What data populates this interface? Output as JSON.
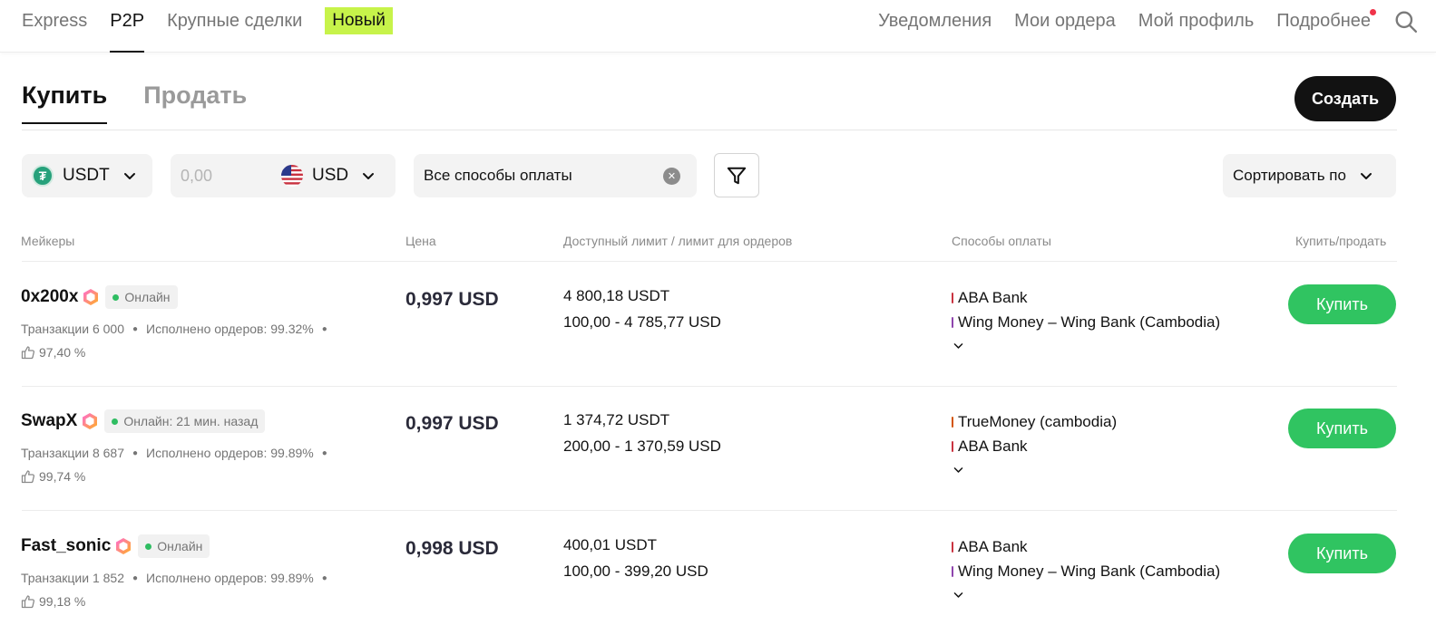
{
  "nav": {
    "left": [
      "Express",
      "P2P",
      "Крупные сделки"
    ],
    "badge": "Новый",
    "right": [
      "Уведомления",
      "Мои ордера",
      "Мой профиль",
      "Подробнее"
    ]
  },
  "tabs": {
    "buy": "Купить",
    "sell": "Продать"
  },
  "create_button": "Создать",
  "filters": {
    "coin": "USDT",
    "amount_placeholder": "0,00",
    "fiat": "USD",
    "payment": "Все способы оплаты",
    "sort": "Сортировать по"
  },
  "columns": [
    "Мейкеры",
    "Цена",
    "Доступный лимит / лимит для ордеров",
    "Способы оплаты",
    "Купить/продать"
  ],
  "colors": {
    "accent_green": "#30c461",
    "badge_lime": "#c7f34a",
    "online_dot": "#2fbd62"
  },
  "rows": [
    {
      "name": "0x200x",
      "status": "Онлайн",
      "transactions": "Транзакции 6 000",
      "completed": "Исполнено ордеров: 99.32%",
      "rating": "97,40 %",
      "price": "0,997 USD",
      "available": "4 800,18 USDT",
      "limits": "100,00 - 4 785,77 USD",
      "payments": [
        {
          "name": "ABA Bank",
          "color": "#c93340"
        },
        {
          "name": "Wing Money – Wing Bank (Cambodia)",
          "color": "#8e44ad"
        }
      ],
      "action": "Купить"
    },
    {
      "name": "SwapX",
      "status": "Онлайн: 21 мин. назад",
      "transactions": "Транзакции 8 687",
      "completed": "Исполнено ордеров: 99.89%",
      "rating": "99,74 %",
      "price": "0,997 USD",
      "available": "1 374,72 USDT",
      "limits": "200,00 - 1 370,59 USD",
      "payments": [
        {
          "name": "TrueMoney (cambodia)",
          "color": "#d35400"
        },
        {
          "name": "ABA Bank",
          "color": "#c93340"
        }
      ],
      "action": "Купить"
    },
    {
      "name": "Fast_sonic",
      "status": "Онлайн",
      "transactions": "Транзакции 1 852",
      "completed": "Исполнено ордеров: 99.89%",
      "rating": "99,18 %",
      "price": "0,998 USD",
      "available": "400,01 USDT",
      "limits": "100,00 - 399,20 USD",
      "payments": [
        {
          "name": "ABA Bank",
          "color": "#c93340"
        },
        {
          "name": "Wing Money – Wing Bank (Cambodia)",
          "color": "#8e44ad"
        }
      ],
      "action": "Купить"
    }
  ]
}
